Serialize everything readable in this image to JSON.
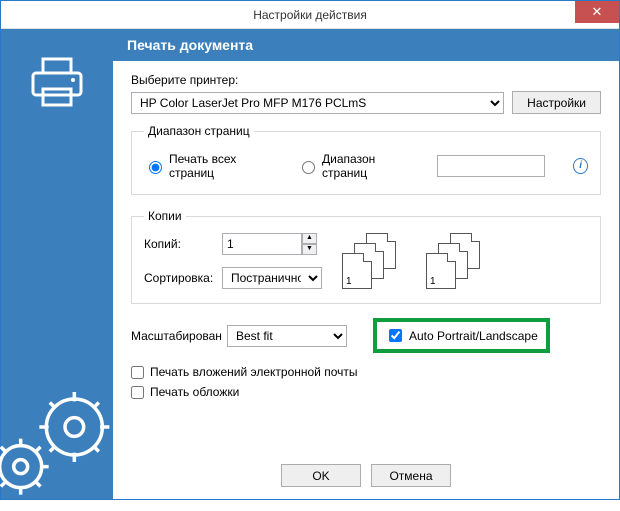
{
  "window": {
    "title": "Настройки действия"
  },
  "header": {
    "title": "Печать документа"
  },
  "printer": {
    "label": "Выберите принтер:",
    "selected": "HP Color LaserJet Pro MFP M176 PCLmS",
    "settings_btn": "Настройки"
  },
  "range": {
    "legend": "Диапазон страниц",
    "all_label": "Печать всех страниц",
    "range_label": "Диапазон страниц",
    "range_value": ""
  },
  "copies": {
    "legend": "Копии",
    "count_label": "Копий:",
    "count_value": "1",
    "collate_label": "Сортировка:",
    "collate_selected": "Постранично"
  },
  "scale": {
    "label": "Масштабирован",
    "selected": "Best fit",
    "auto_checked": true,
    "auto_label": "Auto Portrait/Landscape"
  },
  "check": {
    "attachments": "Печать вложений электронной почты",
    "cover": "Печать обложки"
  },
  "footer": {
    "ok": "OK",
    "cancel": "Отмена"
  }
}
